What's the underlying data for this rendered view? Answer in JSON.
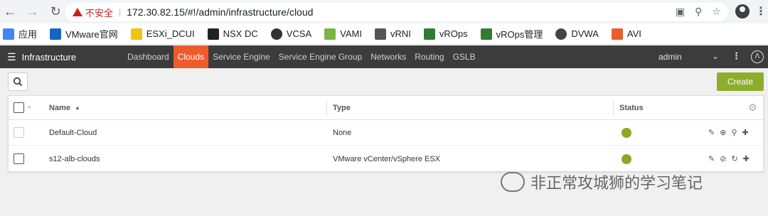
{
  "browser": {
    "security_label": "不安全",
    "url": "172.30.82.15/#!/admin/infrastructure/cloud"
  },
  "bookmarks": [
    {
      "label": "应用",
      "color": "#4285f4"
    },
    {
      "label": "VMware官网",
      "color": "#1565c0"
    },
    {
      "label": "ESXi_DCUI",
      "color": "#f4c20d"
    },
    {
      "label": "NSX DC",
      "color": "#222222"
    },
    {
      "label": "VCSA",
      "color": "#333333"
    },
    {
      "label": "VAMI",
      "color": "#7cb342"
    },
    {
      "label": "vRNI",
      "color": "#555555"
    },
    {
      "label": "vROps",
      "color": "#2e7d32"
    },
    {
      "label": "vROps管理",
      "color": "#2e7d32"
    },
    {
      "label": "DVWA",
      "color": "#444444"
    },
    {
      "label": "AVI",
      "color": "#ee5c2b"
    }
  ],
  "app": {
    "title": "Infrastructure",
    "tabs": [
      "Dashboard",
      "Clouds",
      "Service Engine",
      "Service Engine Group",
      "Networks",
      "Routing",
      "GSLB"
    ],
    "active_tab": "Clouds",
    "user": "admin",
    "accent_color": "#ee5c2b"
  },
  "toolbar": {
    "create_label": "Create"
  },
  "table": {
    "columns": {
      "name": "Name",
      "type": "Type",
      "status": "Status"
    },
    "rows": [
      {
        "name": "Default-Cloud",
        "type": "None",
        "status": "up",
        "status_color": "#8aa828"
      },
      {
        "name": "s12-alb-clouds",
        "type": "VMware vCenter/vSphere ESX",
        "status": "up",
        "status_color": "#8aa828"
      }
    ]
  },
  "watermark": {
    "text": "非正常攻城狮的学习笔记"
  }
}
